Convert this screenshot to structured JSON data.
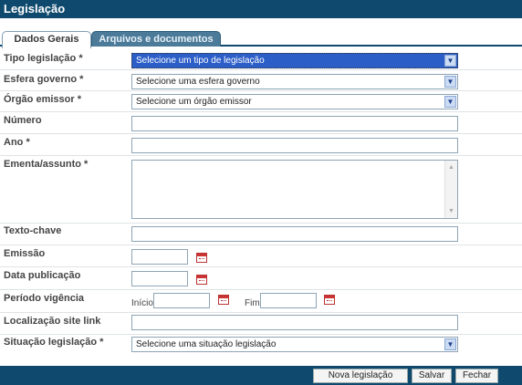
{
  "title": "Legislação",
  "tabs": [
    {
      "label": "Dados Gerais",
      "active": true
    },
    {
      "label": "Arquivos e documentos",
      "active": false
    }
  ],
  "form": {
    "tipo": {
      "label": "Tipo legislação *",
      "value": "Selecione um tipo de legislação"
    },
    "esfera": {
      "label": "Esfera governo *",
      "value": "Selecione uma esfera governo"
    },
    "orgao": {
      "label": "Órgão emissor *",
      "value": "Selecione um órgão emissor"
    },
    "numero": {
      "label": "Número",
      "value": ""
    },
    "ano": {
      "label": "Ano *",
      "value": ""
    },
    "ementa": {
      "label": "Ementa/assunto *",
      "value": ""
    },
    "texto_chave": {
      "label": "Texto-chave",
      "value": ""
    },
    "emissao": {
      "label": "Emissão",
      "value": ""
    },
    "data_publicacao": {
      "label": "Data publicação",
      "value": ""
    },
    "periodo": {
      "label": "Período vigência",
      "inicio_label": "Início",
      "fim_label": "Fim"
    },
    "localizacao": {
      "label": "Localização site link",
      "value": ""
    },
    "situacao": {
      "label": "Situação legislação *",
      "value": "Selecione uma situação legislação"
    }
  },
  "footer": {
    "nova_label": "Nova legislação",
    "salvar_label": "Salvar",
    "fechar_label": "Fechar"
  },
  "colors": {
    "header": "#0f4a6e",
    "selected": "#2c5ec8"
  },
  "icons": [
    "chevron-down-icon",
    "calendar-icon",
    "scroll-up-icon",
    "scroll-down-icon"
  ]
}
